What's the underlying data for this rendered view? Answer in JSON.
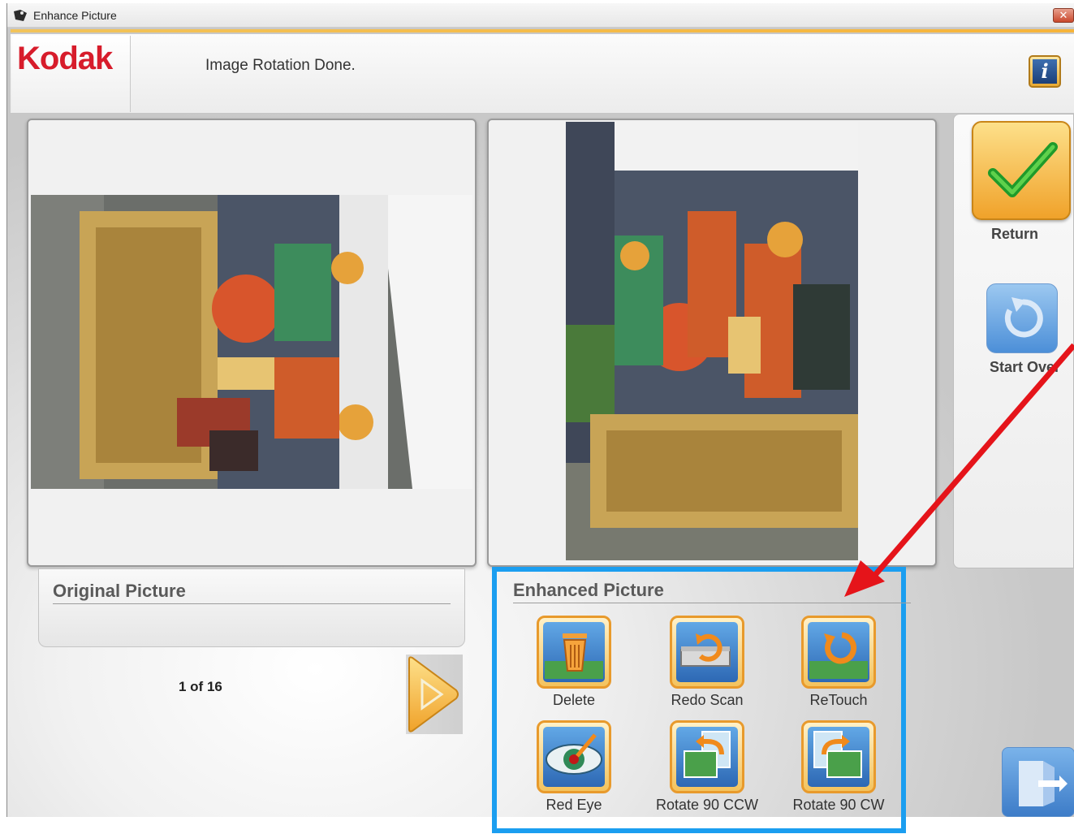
{
  "window": {
    "title": "Enhance Picture",
    "close_label": "✕"
  },
  "header": {
    "logo": "Kodak",
    "status": "Image Rotation Done.",
    "info_label": "i"
  },
  "original": {
    "title": "Original Picture",
    "counter": "1 of 16"
  },
  "enhanced": {
    "title": "Enhanced Picture",
    "tools": [
      {
        "label": "Delete",
        "icon": "trash-icon"
      },
      {
        "label": "Redo Scan",
        "icon": "redo-scan-icon"
      },
      {
        "label": "ReTouch",
        "icon": "retouch-icon"
      },
      {
        "label": "Red Eye",
        "icon": "red-eye-icon"
      },
      {
        "label": "Rotate 90 CCW",
        "icon": "rotate-ccw-icon"
      },
      {
        "label": "Rotate 90 CW",
        "icon": "rotate-cw-icon"
      }
    ]
  },
  "side": {
    "return_label": "Return",
    "start_over_label": "Start Over"
  },
  "colors": {
    "kodak_red": "#d71c2b",
    "accent_orange": "#f0a22a",
    "highlight_blue": "#1b9ef0",
    "arrow_red": "#e5141a"
  }
}
